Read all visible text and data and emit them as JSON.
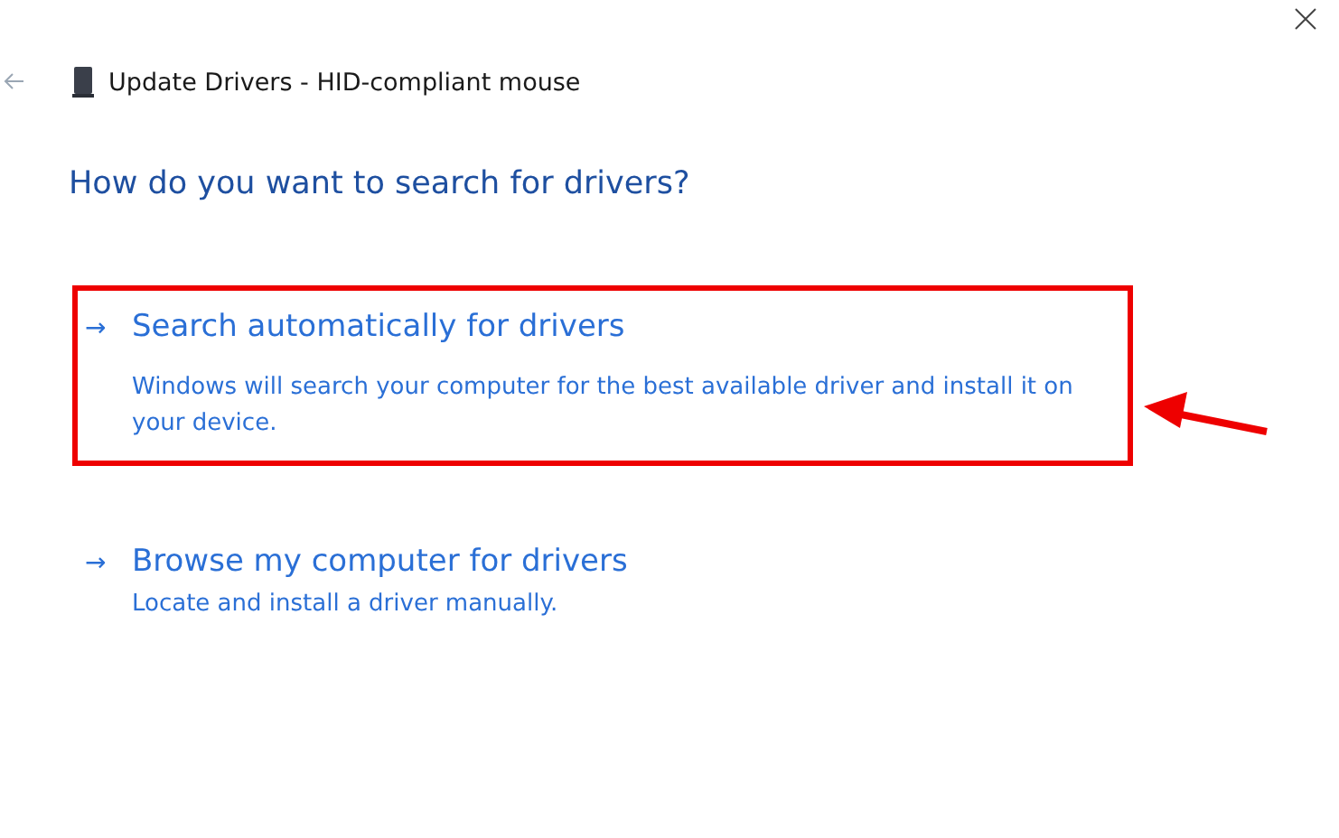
{
  "window": {
    "title": "Update Drivers - HID-compliant mouse"
  },
  "heading": "How do you want to search for drivers?",
  "options": [
    {
      "arrow": "→",
      "title": "Search automatically for drivers",
      "description": "Windows will search your computer for the best available driver and install it on your device.",
      "highlighted": true
    },
    {
      "arrow": "→",
      "title": "Browse my computer for drivers",
      "description": "Locate and install a driver manually.",
      "highlighted": false
    }
  ]
}
